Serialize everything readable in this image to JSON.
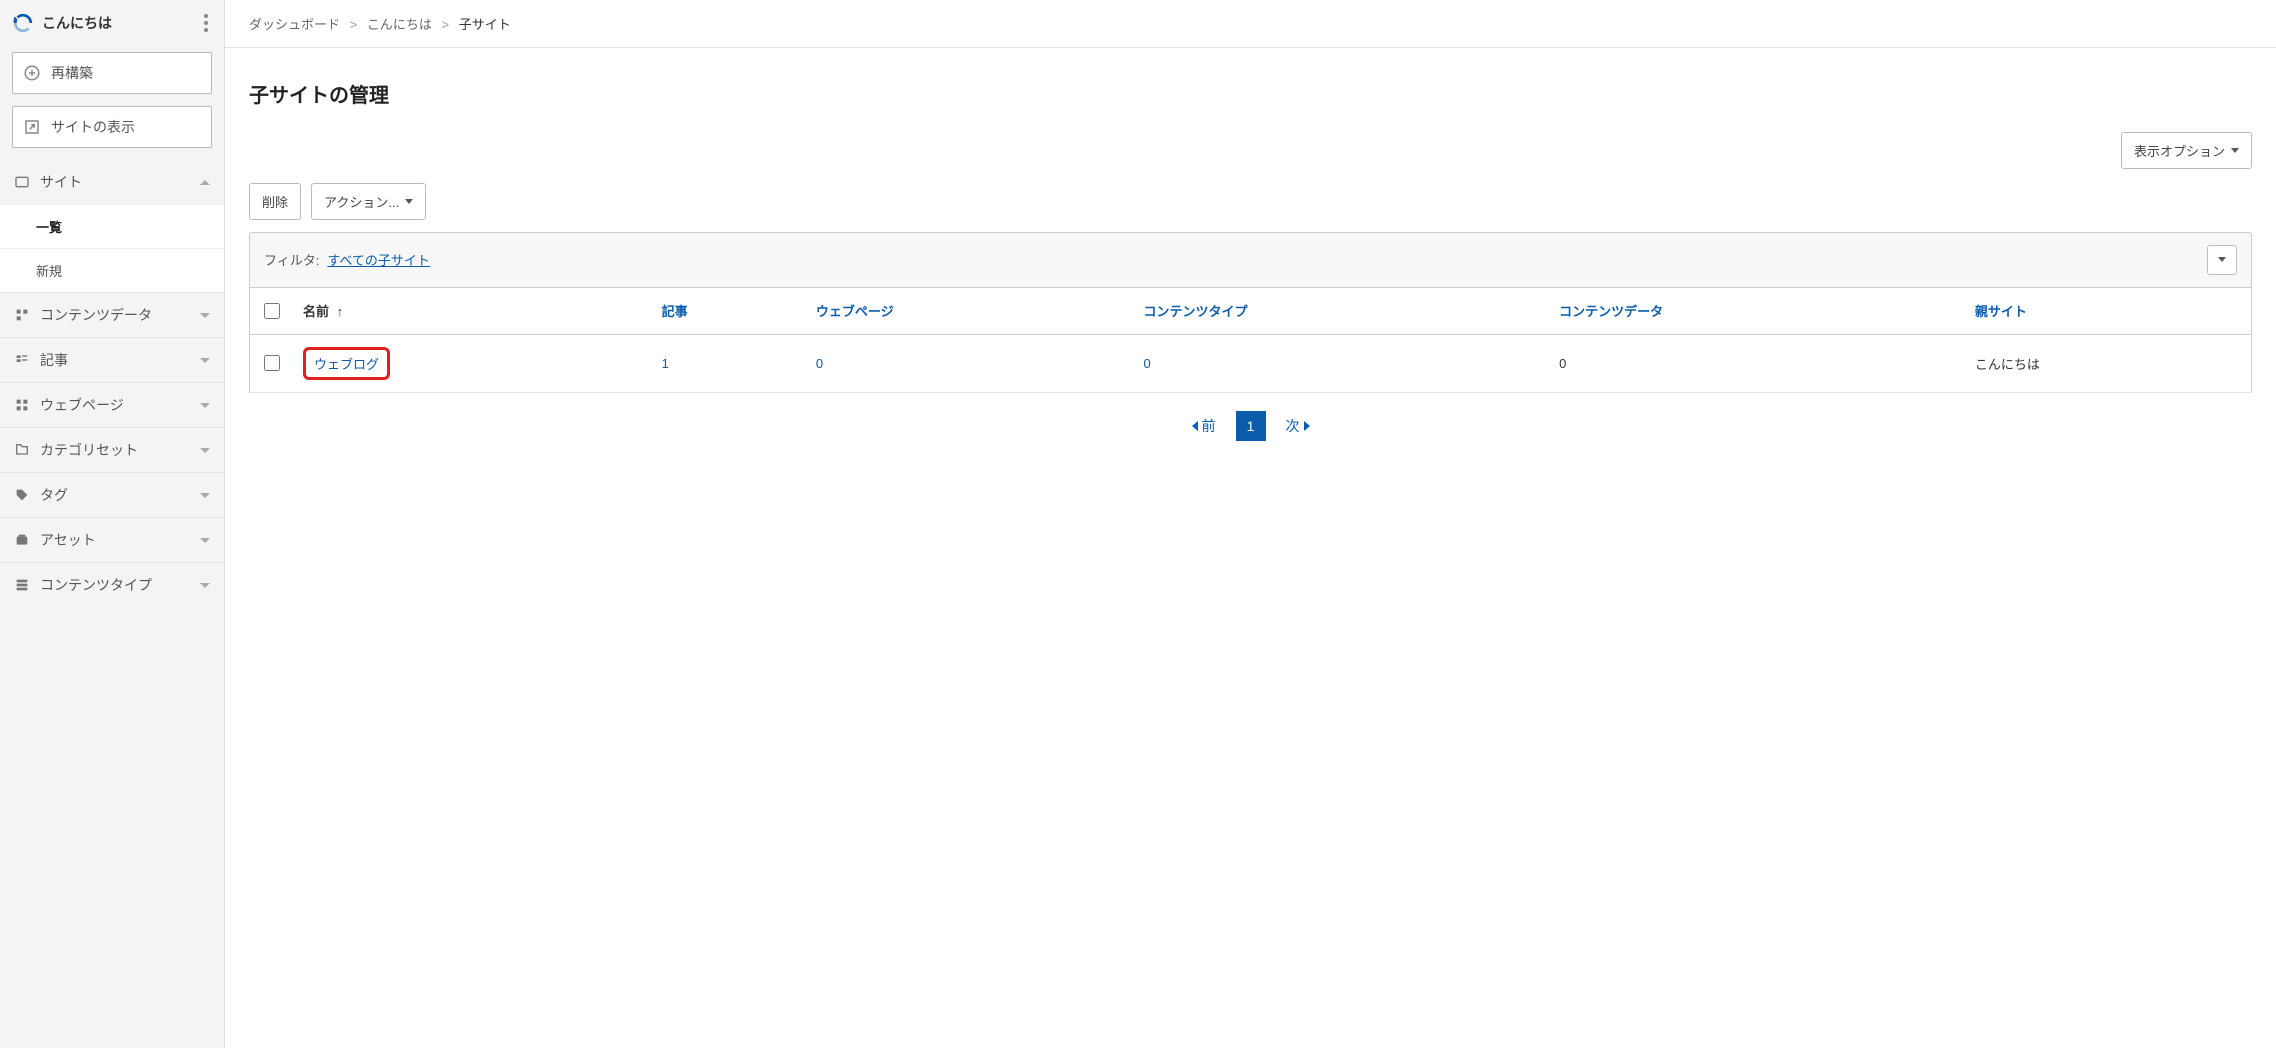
{
  "sidebar": {
    "brand_name": "こんにちは",
    "rebuild_label": "再構築",
    "view_site_label": "サイトの表示",
    "groups": [
      {
        "id": "site",
        "label": "サイト",
        "open": true,
        "sub": [
          {
            "id": "list",
            "label": "一覧",
            "active": true
          },
          {
            "id": "new",
            "label": "新規",
            "active": false
          }
        ]
      },
      {
        "id": "content-data",
        "label": "コンテンツデータ",
        "open": false
      },
      {
        "id": "entries",
        "label": "記事",
        "open": false
      },
      {
        "id": "pages",
        "label": "ウェブページ",
        "open": false
      },
      {
        "id": "category-sets",
        "label": "カテゴリセット",
        "open": false
      },
      {
        "id": "tags",
        "label": "タグ",
        "open": false
      },
      {
        "id": "assets",
        "label": "アセット",
        "open": false
      },
      {
        "id": "content-types",
        "label": "コンテンツタイプ",
        "open": false
      }
    ]
  },
  "breadcrumb": {
    "items": [
      {
        "label": "ダッシュボード",
        "link": true
      },
      {
        "label": "こんにちは",
        "link": true
      },
      {
        "label": "子サイト",
        "link": false
      }
    ],
    "sep": ">"
  },
  "page": {
    "title": "子サイトの管理",
    "display_options": "表示オプション",
    "delete_label": "削除",
    "actions_label": "アクション...",
    "filter_label": "フィルタ:",
    "filter_value": "すべての子サイト"
  },
  "table": {
    "columns": {
      "name": "名前",
      "entries": "記事",
      "pages": "ウェブページ",
      "content_types": "コンテンツタイプ",
      "content_data": "コンテンツデータ",
      "parent": "親サイト"
    },
    "sort_arrow": "↑",
    "rows": [
      {
        "name": "ウェブログ",
        "entries": "1",
        "pages": "0",
        "content_types": "0",
        "content_data": "0",
        "parent": "こんにちは",
        "highlight": true
      }
    ]
  },
  "pagination": {
    "prev": "前",
    "next": "次",
    "current": "1"
  }
}
